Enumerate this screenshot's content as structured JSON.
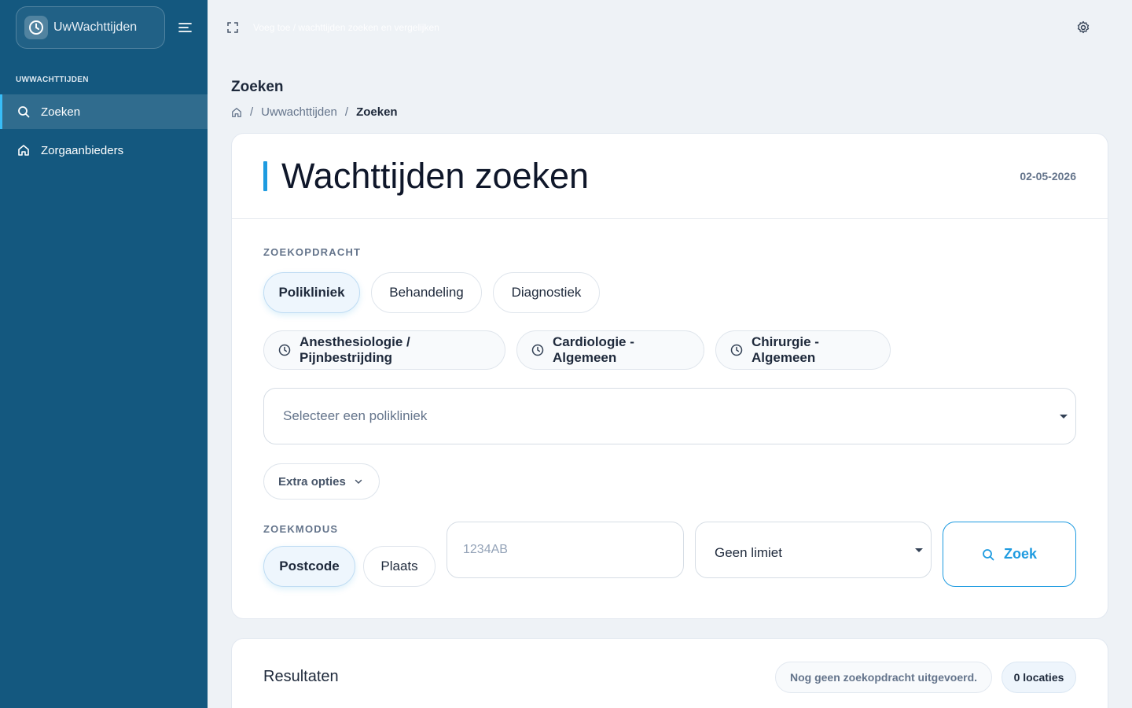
{
  "app": {
    "name": "UwWachttijden"
  },
  "sidebar": {
    "section_label": "UWWACHTTIJDEN",
    "items": [
      {
        "label": "Zoeken",
        "icon": "search-icon",
        "active": true
      },
      {
        "label": "Zorgaanbieders",
        "icon": "home-icon",
        "active": false
      }
    ]
  },
  "topbar": {
    "hint": "Voeg toe / wachttijden zoeken en vergelijken"
  },
  "page": {
    "title": "Zoeken",
    "breadcrumb": [
      "Uwwachttijden",
      "Zoeken"
    ]
  },
  "search_card": {
    "title": "Wachttijden zoeken",
    "date": "02-05-2026",
    "zoekopdracht_label": "ZOEKOPDRACHT",
    "type_options": [
      "Polikliniek",
      "Behandeling",
      "Diagnostiek"
    ],
    "selected_type": "Polikliniek",
    "quick_chips": [
      "Anesthesiologie / Pijnbestrijding",
      "Cardiologie - Algemeen",
      "Chirurgie - Algemeen"
    ],
    "polikliniek_placeholder": "Selecteer een polikliniek",
    "extra_options_label": "Extra opties",
    "zoekmodus_label": "ZOEKMODUS",
    "mode_options": [
      "Postcode",
      "Plaats"
    ],
    "selected_mode": "Postcode",
    "postcode_placeholder": "1234AB",
    "limit_value": "Geen limiet",
    "search_button": "Zoek"
  },
  "results": {
    "title": "Resultaten",
    "status": "Nog geen zoekopdracht uitgevoerd.",
    "count": "0 locaties"
  },
  "colors": {
    "sidebar_bg": "#14587f",
    "accent": "#1e9be0",
    "page_bg": "#eef2f6"
  }
}
